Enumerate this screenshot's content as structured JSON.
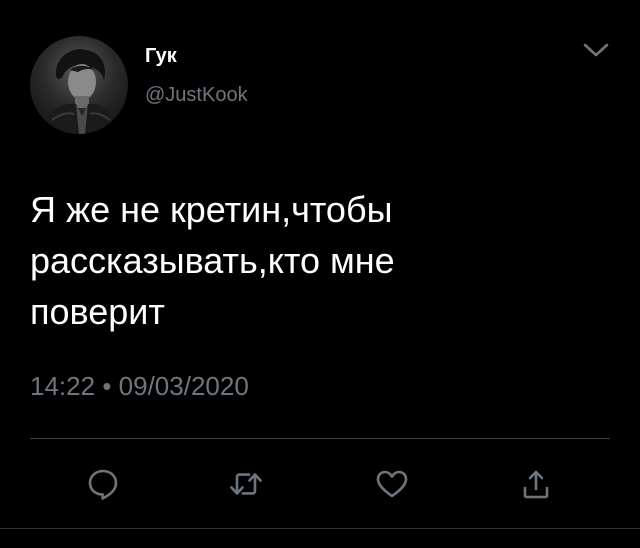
{
  "user": {
    "display_name": "Гук",
    "handle": "@JustKook",
    "avatar_icon": "profile-photo"
  },
  "tweet": {
    "text": "Я же не кретин,чтобы\nрассказывать,кто мне\nповерит",
    "time": "14:22",
    "separator": "•",
    "date": "09/03/2020"
  },
  "actions": [
    {
      "name": "reply",
      "icon": "speech-bubble-icon"
    },
    {
      "name": "retweet",
      "icon": "retweet-icon"
    },
    {
      "name": "like",
      "icon": "heart-icon"
    },
    {
      "name": "share",
      "icon": "share-icon"
    }
  ],
  "menu": {
    "icon": "chevron-down-icon"
  },
  "colors": {
    "background": "#000000",
    "text_primary": "#ffffff",
    "text_secondary": "#6e767d",
    "divider": "#38444d"
  }
}
